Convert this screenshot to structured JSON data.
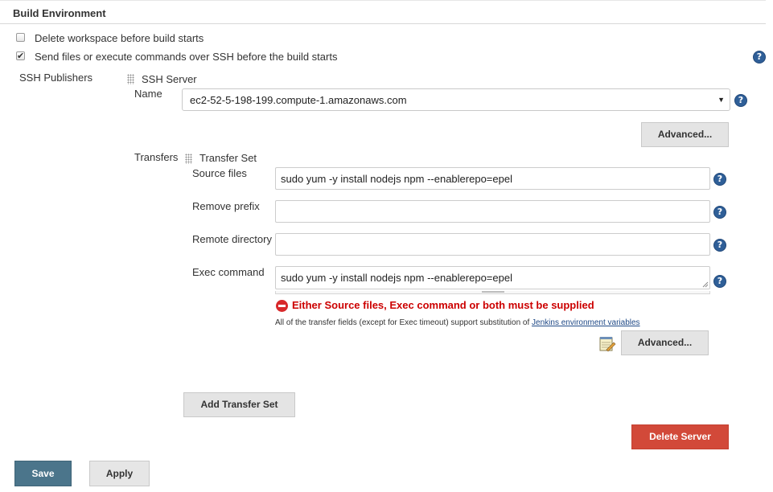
{
  "section": {
    "title": "Build Environment"
  },
  "options": {
    "delete_workspace": {
      "label": "Delete workspace before build starts",
      "checked": false
    },
    "send_files_ssh": {
      "label": "Send files or execute commands over SSH before the build starts",
      "checked": true
    }
  },
  "ssh_publishers": {
    "label": "SSH Publishers",
    "server": {
      "header": "SSH Server",
      "name_label": "Name",
      "name_value": "ec2-52-5-198-199.compute-1.amazonaws.com",
      "advanced_label": "Advanced...",
      "transfers_label": "Transfers",
      "transfer_set": {
        "header": "Transfer Set",
        "source_files_label": "Source files",
        "source_files_value": "sudo yum -y install nodejs npm --enablerepo=epel",
        "remove_prefix_label": "Remove prefix",
        "remove_prefix_value": "",
        "remote_directory_label": "Remote directory",
        "remote_directory_value": "",
        "exec_command_label": "Exec command",
        "exec_command_value": "sudo yum -y install nodejs npm --enablerepo=epel",
        "error_text": "Either Source files, Exec command or both must be supplied",
        "note_text": "All of the transfer fields (except for Exec timeout) support substitution of ",
        "note_link": "Jenkins environment variables",
        "advanced_label": "Advanced..."
      },
      "add_transfer_set_label": "Add Transfer Set",
      "delete_server_label": "Delete Server"
    }
  },
  "footer": {
    "save_label": "Save",
    "apply_label": "Apply"
  },
  "icons": {
    "help": "help-question-icon",
    "error": "error-minus-icon",
    "grip": "drag-handle-icon",
    "notepad": "notepad-icon"
  },
  "colors": {
    "help_blue": "#2f5f98",
    "error_red": "#cc0000",
    "delete_red": "#d24939",
    "save_blue": "#4b758b",
    "link_blue": "#204a87"
  }
}
